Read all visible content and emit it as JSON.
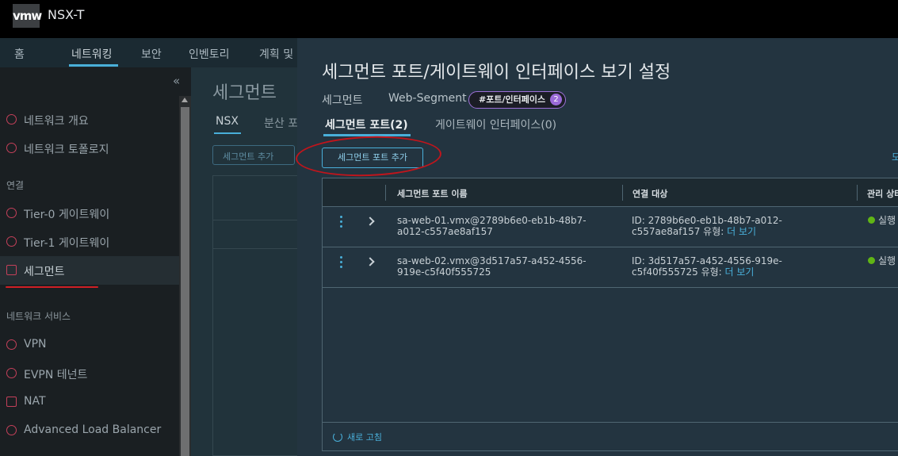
{
  "header": {
    "logo": "vmw",
    "app_title": "NSX-T"
  },
  "main_nav": {
    "tabs": [
      "홈",
      "네트워킹",
      "보안",
      "인벤토리",
      "계획 및"
    ]
  },
  "sidebar": {
    "collapse_icon": "«",
    "items_a": [
      "네트워크 개요",
      "네트워크 토폴로지"
    ],
    "section_connect": "연결",
    "items_b": [
      "Tier-0 게이트웨이",
      "Tier-1 게이트웨이",
      "세그먼트"
    ],
    "section_services": "네트워크 서비스",
    "items_c": [
      "VPN",
      "EVPN 테넌트",
      "NAT",
      "Advanced Load Balancer"
    ]
  },
  "background": {
    "title": "세그먼트",
    "tabs": [
      "NSX",
      "분산 포"
    ],
    "add_button": "세그먼트 추가"
  },
  "modal": {
    "title": "세그먼트 포트/게이트웨이 인터페이스 보기 설정",
    "meta_label": "세그먼트",
    "segment_name": "Web-Segment",
    "tag_label": "#포트/인터페이스",
    "tag_count": "2",
    "tabs": [
      "세그먼트 포트(2)",
      "게이트웨이 인터페이스(0)"
    ],
    "add_port_button": "세그먼트 포트 추가",
    "right_link": "모",
    "columns": [
      "세그먼트 포트 이름",
      "연결 대상",
      "관리 상태"
    ],
    "rows": [
      {
        "name_line1": "sa-web-01.vmx@2789b6e0-eb1b-48b7-",
        "name_line2": "a012-c557ae8af157",
        "target_line1": "ID: 2789b6e0-eb1b-48b7-a012-",
        "target_line2": "c557ae8af157 유형:",
        "more": "더 보기",
        "status": "실행"
      },
      {
        "name_line1": "sa-web-02.vmx@3d517a57-a452-4556-",
        "name_line2": "919e-c5f40f555725",
        "target_line1": "ID: 3d517a57-a452-4556-919e-",
        "target_line2": "c5f40f555725 유형:",
        "more": "더 보기",
        "status": "실행"
      }
    ],
    "refresh": "새로 고침"
  },
  "colors": {
    "accent": "#49afd9",
    "status_ok": "#60b515",
    "annotation": "#c0151c"
  }
}
